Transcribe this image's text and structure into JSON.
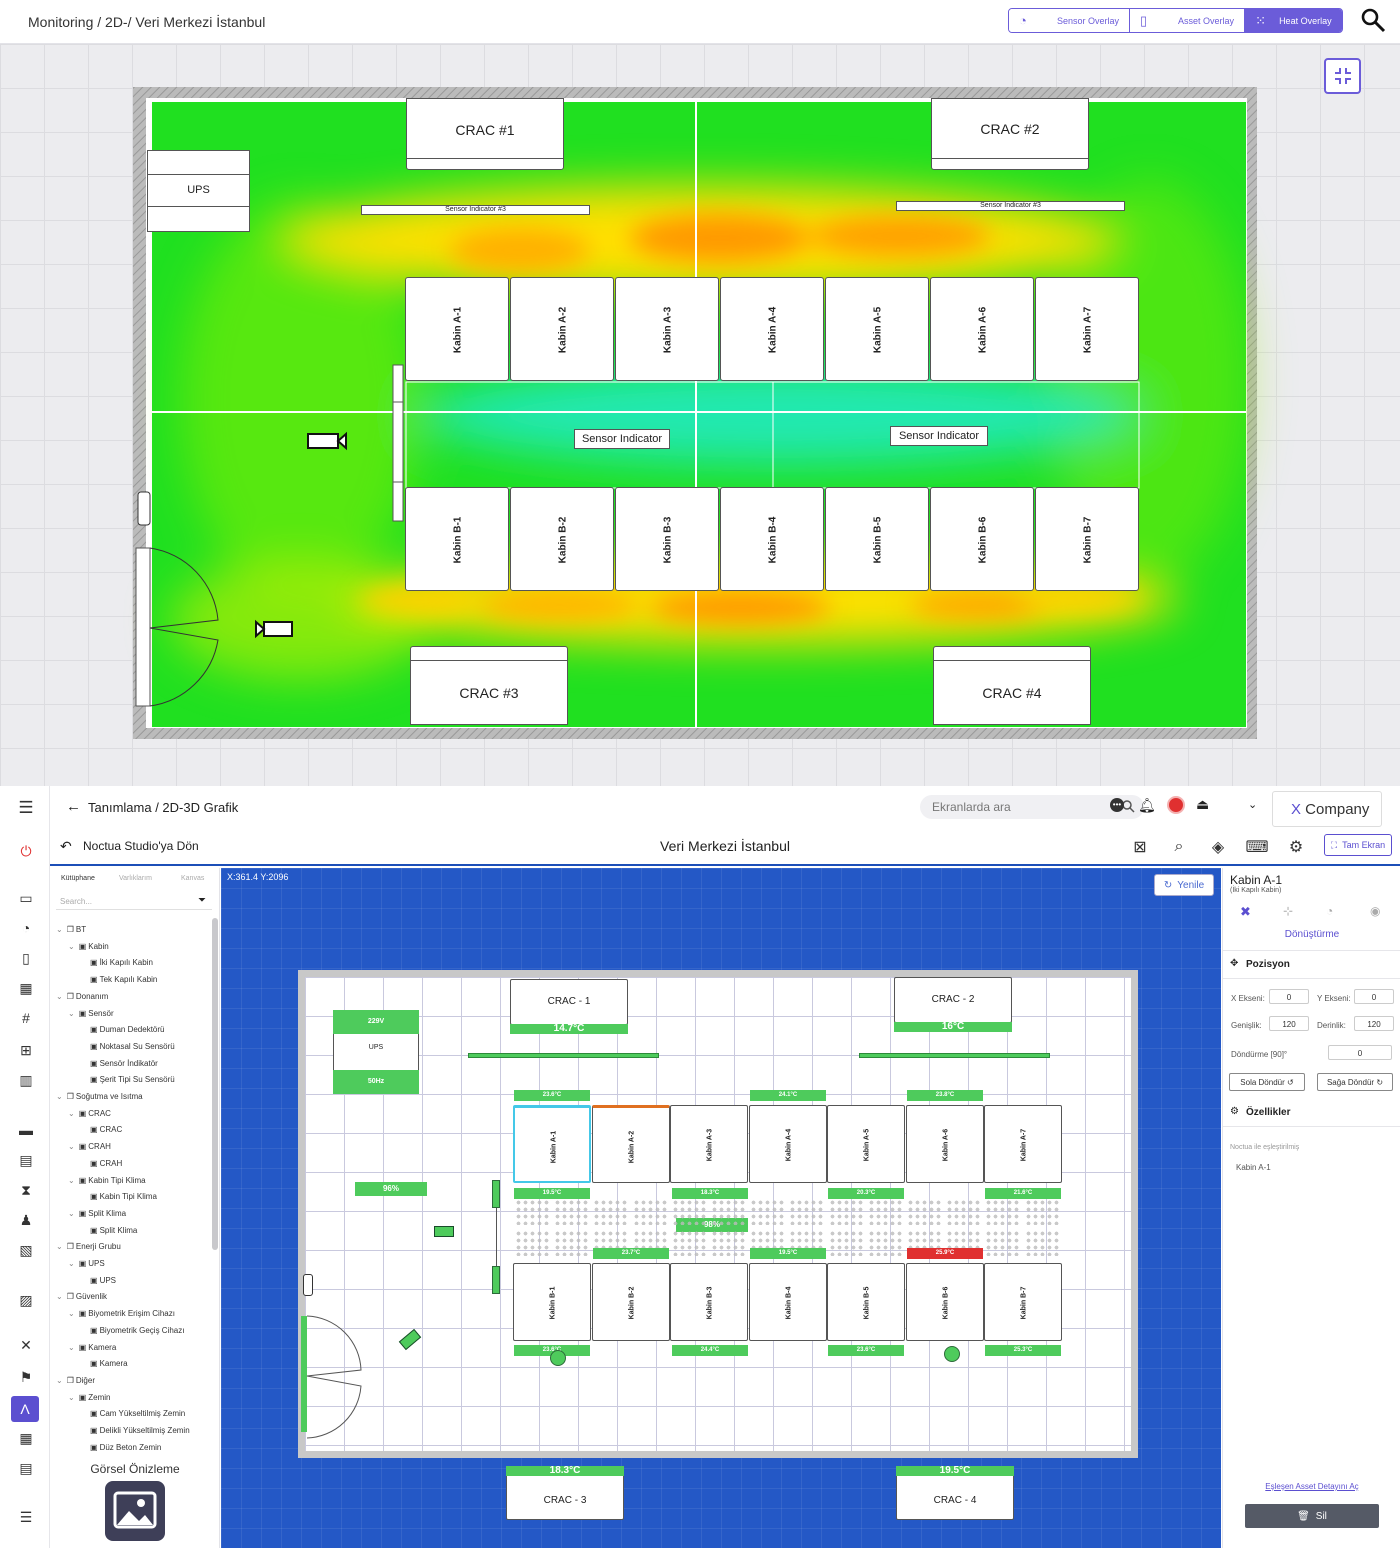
{
  "top": {
    "breadcrumb": "Monitoring / 2D-/ Veri Merkezi İstanbul",
    "overlay_buttons": [
      {
        "label": "Sensor Overlay",
        "icon": "gauge-icon",
        "active": false
      },
      {
        "label": "Asset Overlay",
        "icon": "rack-icon",
        "active": false
      },
      {
        "label": "Heat Overlay",
        "icon": "grid-icon",
        "active": true
      }
    ],
    "accent_color": "#6b5cd9",
    "floor": {
      "crac": [
        "CRAC #1",
        "CRAC #2",
        "CRAC #3",
        "CRAC #4"
      ],
      "ups": "UPS",
      "sensor_bars": [
        "Sensor Indicator #3",
        "Sensor Indicator #3"
      ],
      "sensor_labels": [
        "Sensor Indicator",
        "Sensor Indicator"
      ],
      "row_a": [
        "Kabin A-1",
        "Kabin A-2",
        "Kabin A-3",
        "Kabin A-4",
        "Kabin A-5",
        "Kabin A-6",
        "Kabin A-7"
      ],
      "row_b": [
        "Kabin B-1",
        "Kabin B-2",
        "Kabin B-3",
        "Kabin B-4",
        "Kabin B-5",
        "Kabin B-6",
        "Kabin B-7"
      ]
    }
  },
  "appbar": {
    "breadcrumb": "Tanımlama / 2D-3D Grafik",
    "search_placeholder": "Ekranlarda ara",
    "company_x": "X",
    "company_name": " Company"
  },
  "studiobar": {
    "back_label": "Noctua Studio'ya Dön",
    "title": "Veri Merkezi İstanbul",
    "fullscreen_label": "Tam Ekran"
  },
  "library": {
    "tabs": [
      "Kütüphane",
      "Varlıklarım",
      "Kanvas"
    ],
    "search_placeholder": "Search...",
    "tree": [
      {
        "label": "BT",
        "level": 0,
        "caret": true
      },
      {
        "label": "Kabin",
        "level": 1,
        "caret": true
      },
      {
        "label": "İki Kapılı Kabin",
        "level": 2,
        "caret": false
      },
      {
        "label": "Tek Kapılı Kabin",
        "level": 2,
        "caret": false
      },
      {
        "label": "Donanım",
        "level": 0,
        "caret": true
      },
      {
        "label": "Sensör",
        "level": 1,
        "caret": true
      },
      {
        "label": "Duman Dedektörü",
        "level": 2,
        "caret": false
      },
      {
        "label": "Noktasal Su Sensörü",
        "level": 2,
        "caret": false
      },
      {
        "label": "Sensör İndikatör",
        "level": 2,
        "caret": false
      },
      {
        "label": "Şerit Tipi Su Sensörü",
        "level": 2,
        "caret": false
      },
      {
        "label": "Soğutma ve Isıtma",
        "level": 0,
        "caret": true
      },
      {
        "label": "CRAC",
        "level": 1,
        "caret": true
      },
      {
        "label": "CRAC",
        "level": 2,
        "caret": false
      },
      {
        "label": "CRAH",
        "level": 1,
        "caret": true
      },
      {
        "label": "CRAH",
        "level": 2,
        "caret": false
      },
      {
        "label": "Kabin Tipi Klima",
        "level": 1,
        "caret": true
      },
      {
        "label": "Kabin Tipi Klima",
        "level": 2,
        "caret": false
      },
      {
        "label": "Split Klima",
        "level": 1,
        "caret": true
      },
      {
        "label": "Split Klima",
        "level": 2,
        "caret": false
      },
      {
        "label": "Enerji Grubu",
        "level": 0,
        "caret": true
      },
      {
        "label": "UPS",
        "level": 1,
        "caret": true
      },
      {
        "label": "UPS",
        "level": 2,
        "caret": false
      },
      {
        "label": "Güvenlik",
        "level": 0,
        "caret": true
      },
      {
        "label": "Biyometrik Erişim Cihazı",
        "level": 1,
        "caret": true
      },
      {
        "label": "Biyometrik Geçiş Cihazı",
        "level": 2,
        "caret": false
      },
      {
        "label": "Kamera",
        "level": 1,
        "caret": true
      },
      {
        "label": "Kamera",
        "level": 2,
        "caret": false
      },
      {
        "label": "Diğer",
        "level": 0,
        "caret": true
      },
      {
        "label": "Zemin",
        "level": 1,
        "caret": true
      },
      {
        "label": "Cam Yükseltilmiş Zemin",
        "level": 2,
        "caret": false
      },
      {
        "label": "Delikli Yükseltilmiş Zemin",
        "level": 2,
        "caret": false
      },
      {
        "label": "Düz Beton Zemin",
        "level": 2,
        "caret": false
      }
    ],
    "preview_title": "Görsel Önizleme"
  },
  "canvas": {
    "coordinates": "X:361.4 Y:2096",
    "refresh_label": "Yenile",
    "crac": [
      {
        "name": "CRAC - 1",
        "temp": "14.7°C"
      },
      {
        "name": "CRAC - 2",
        "temp": "16°C"
      },
      {
        "name": "CRAC - 3",
        "temp": "18.3°C"
      },
      {
        "name": "CRAC - 4",
        "temp": "19.5°C"
      }
    ],
    "ups": {
      "top": "229V",
      "name": "UPS",
      "bottom": "50Hz"
    },
    "humidity": [
      "96%",
      "98%"
    ],
    "row_a": [
      "Kabin A-1",
      "Kabin A-2",
      "Kabin A-3",
      "Kabin A-4",
      "Kabin A-5",
      "Kabin A-6",
      "Kabin A-7"
    ],
    "row_b": [
      "Kabin B-1",
      "Kabin B-2",
      "Kabin B-3",
      "Kabin B-4",
      "Kabin B-5",
      "Kabin B-6",
      "Kabin B-7"
    ],
    "temps_above_a": [
      "23.6°C",
      "24.1°C",
      "23.8°C"
    ],
    "temps_below_a": [
      "19.5°C",
      "18.3°C",
      "20.3°C",
      "21.6°C"
    ],
    "temps_mid": [
      "23.7°C",
      "19.5°C",
      "25.9°C"
    ],
    "temps_below_b": [
      "23.6°C",
      "24.4°C",
      "23.6°C",
      "25.3°C"
    ],
    "alert_color": "#e03030",
    "ok_color": "#4ecb5c"
  },
  "props": {
    "title": "Kabin A-1",
    "subtitle": "(İki Kapılı Kabin)",
    "section": "Dönüştürme",
    "position_label": "Pozisyon",
    "x_label": "X Ekseni:",
    "x_value": "0",
    "y_label": "Y Ekseni:",
    "y_value": "0",
    "width_label": "Genişlik:",
    "width_value": "120",
    "depth_label": "Derinlik:",
    "depth_value": "120",
    "rotation_label": "Döndürme [90]°",
    "rotation_value": "0",
    "rotate_left": "Sola Döndür",
    "rotate_right": "Sağa Döndür",
    "features_label": "Özellikler",
    "paired_label": "Noctua ile eşleştirilmiş",
    "paired_value": "Kabin A-1",
    "detail_link": "Eşleşen Asset Detayını Aç",
    "delete_label": "Sil"
  }
}
